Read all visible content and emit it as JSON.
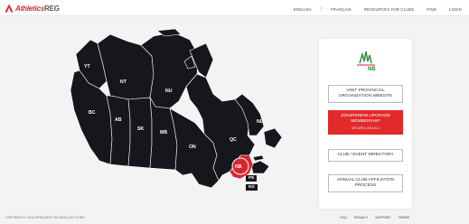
{
  "header": {
    "logo_text": "Athletics",
    "logo_text_suffix": "REG",
    "nav": [
      "ENGLISH",
      "FRANÇAIS",
      "RESOURCES FOR CLUBS",
      "FIND",
      "LOGIN"
    ],
    "separator": "|"
  },
  "map": {
    "provinces": [
      "YT",
      "NT",
      "NU",
      "BC",
      "AB",
      "SK",
      "MB",
      "ON",
      "QC",
      "NL",
      "NB",
      "PE",
      "NS"
    ]
  },
  "panel": {
    "org_logo_text": "NB",
    "buttons": [
      {
        "label": "VISIT PROVINCIAL ORGANIZATION WEBSITE"
      },
      {
        "label": "JOIN/RENEW UPGRADE MEMBERSHIP",
        "sub": "UPDATED: 2024-01-1"
      },
      {
        "label": "CLUB / EVENT DIRECTORY"
      },
      {
        "label": "ANNUAL CLUB AFFILIATION PROCESS"
      }
    ]
  },
  "footer": {
    "copyright": "COPYRIGHT © 2024 UPSOURCE TECHNOLOGY CORP.",
    "links": [
      "FAQ",
      "PRIVACY",
      "SUPPORT",
      "TERMS"
    ]
  },
  "colors": {
    "accent": "#d7262f",
    "map": "#16161d"
  }
}
